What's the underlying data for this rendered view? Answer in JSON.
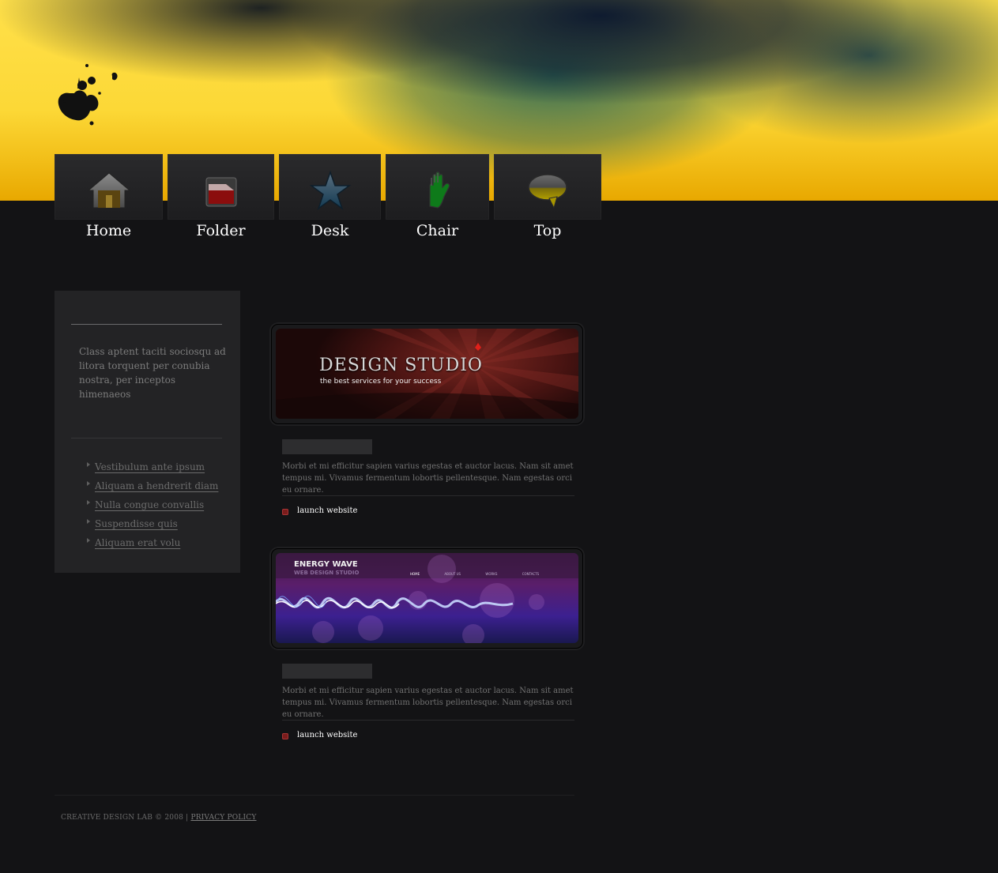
{
  "nav": [
    {
      "label": "Home",
      "icon": "home-icon"
    },
    {
      "label": "Folder",
      "icon": "folder-icon"
    },
    {
      "label": "Desk",
      "icon": "star-icon"
    },
    {
      "label": "Chair",
      "icon": "hand-icon"
    },
    {
      "label": "Top",
      "icon": "speech-bubble-icon"
    }
  ],
  "sidebar": {
    "intro": "Class aptent taciti sociosqu ad litora torquent per conubia nostra, per inceptos himenaeos",
    "links": [
      "Vestibulum ante ipsum",
      "Aliquam a hendrerit diam",
      "Nulla congue convallis",
      "Suspendisse quis",
      "Aliquam erat volu"
    ]
  },
  "projects": [
    {
      "thumb_title": "DESIGN STUDIO",
      "thumb_subtitle": "the best services for your success",
      "title": "",
      "description": "Morbi et mi efficitur sapien varius egestas et auctor lacus. Nam sit amet tempus mi. Vivamus fermentum lobortis pellentesque. Nam egestas orci eu ornare.",
      "link_label": "launch website"
    },
    {
      "thumb_title": "ENERGY WAVE",
      "thumb_subtitle": "WEB DESIGN STUDIO",
      "thumb_nav": [
        "HOME",
        "ABOUT US",
        "WORKS",
        "CONTACTS"
      ],
      "title": "",
      "description": "Morbi et mi efficitur sapien varius egestas et auctor lacus. Nam sit amet tempus mi. Vivamus fermentum lobortis pellentesque. Nam egestas orci eu ornare.",
      "link_label": "launch website"
    }
  ],
  "footer": {
    "copyright": "CREATIVE DESIGN LAB © 2008 | ",
    "privacy_label": "PRIVACY POLICY"
  }
}
